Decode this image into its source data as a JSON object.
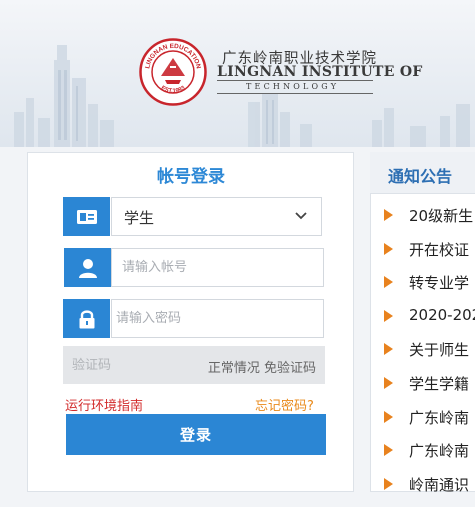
{
  "header": {
    "school_name_cn": "广东岭南职业技术学院",
    "school_name_en": "LINGNAN INSTITUTE OF",
    "school_name_en2": "TECHNOLOGY",
    "emblem_text_top": "LINGNAN EDUCATION",
    "emblem_text_bottom": "EST.1993"
  },
  "login": {
    "title": "帐号登录",
    "role_value": "学生",
    "account_placeholder": "请输入帐号",
    "password_placeholder": "请输入密码",
    "captcha_placeholder": "验证码",
    "captcha_status": "正常情况  免验证码",
    "env_guide_link": "运行环境指南",
    "forgot_password_link": "忘记密码?",
    "login_button": "登录"
  },
  "notices": {
    "title": "通知公告",
    "items": [
      {
        "label": "20级新生"
      },
      {
        "label": "开在校证"
      },
      {
        "label": "转专业学"
      },
      {
        "label": "2020-202"
      },
      {
        "label": "关于师生"
      },
      {
        "label": "学生学籍"
      },
      {
        "label": "广东岭南"
      },
      {
        "label": "广东岭南"
      },
      {
        "label": "岭南通识"
      }
    ]
  },
  "colors": {
    "accent": "#2b86d4",
    "link_red": "#d22b2b",
    "link_orange": "#e98a1b",
    "notice_arrow": "#e8821e",
    "emblem_red": "#c8252c"
  }
}
